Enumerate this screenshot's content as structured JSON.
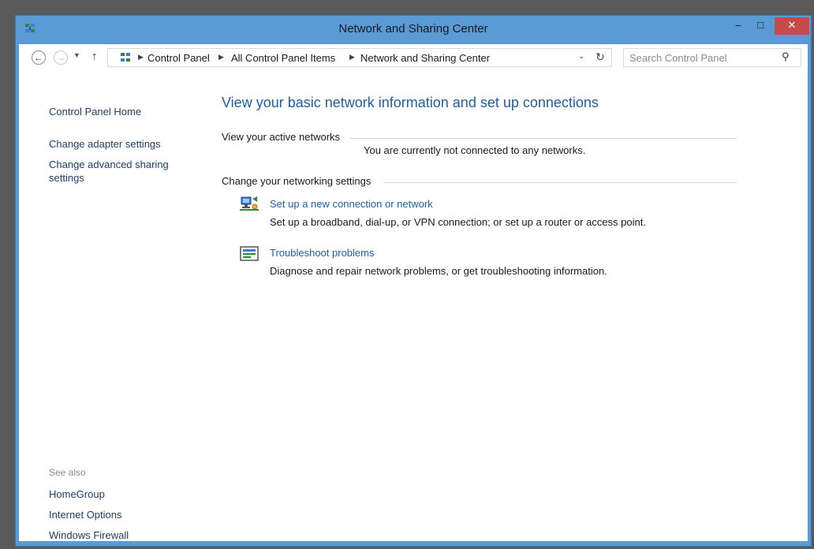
{
  "window": {
    "title": "Network and Sharing Center",
    "controls": {
      "minimize": "–",
      "maximize": "□",
      "close": "✕"
    }
  },
  "addressbar": {
    "back": "←",
    "forward": "→",
    "up": "↑",
    "breadcrumbs": [
      "Control Panel",
      "All Control Panel Items",
      "Network and Sharing Center"
    ],
    "search_placeholder": "Search Control Panel"
  },
  "sidebar": {
    "home": "Control Panel Home",
    "links": [
      "Change adapter settings",
      "Change advanced sharing settings"
    ],
    "see_also_label": "See also",
    "see_also": [
      "HomeGroup",
      "Internet Options",
      "Windows Firewall"
    ]
  },
  "main": {
    "title": "View your basic network information and set up connections",
    "active_networks_label": "View your active networks",
    "active_networks_status": "You are currently not connected to any networks.",
    "change_settings_label": "Change your networking settings",
    "tasks": [
      {
        "link": "Set up a new connection or network",
        "description": "Set up a broadband, dial-up, or VPN connection; or set up a router or access point."
      },
      {
        "link": "Troubleshoot problems",
        "description": "Diagnose and repair network problems, or get troubleshooting information."
      }
    ]
  },
  "colors": {
    "titlebar": "#5b9bd5",
    "close_button": "#c94a4a",
    "link": "#1e5fa8",
    "sidebar_link": "#1e3f66"
  }
}
